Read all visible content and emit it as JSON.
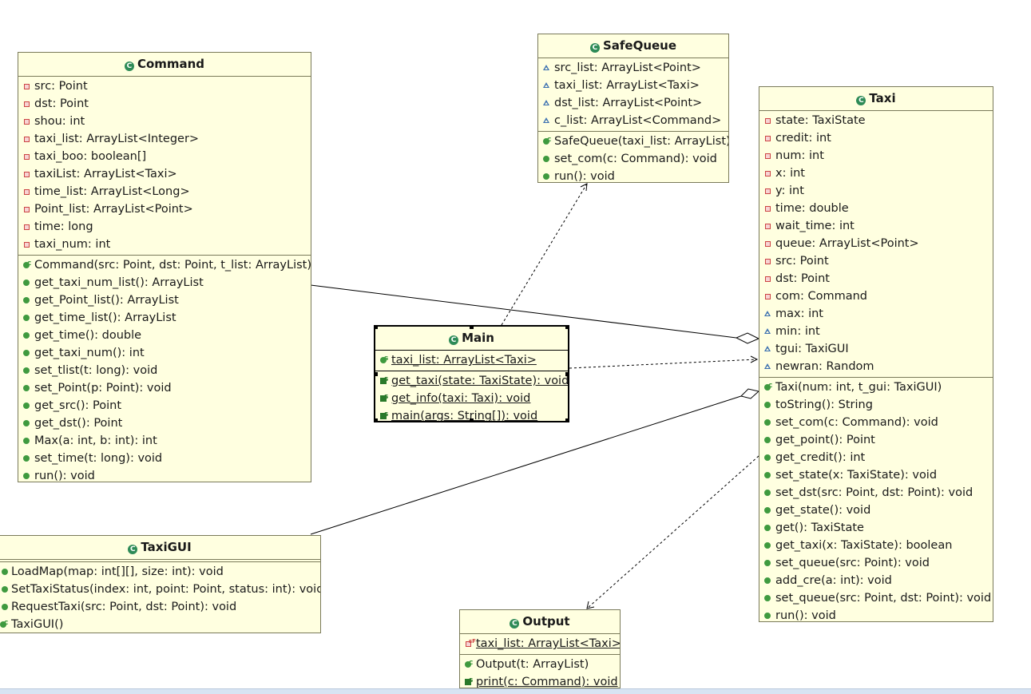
{
  "classes": {
    "command": {
      "name": "Command",
      "attrs": [
        "src: Point",
        "dst: Point",
        "shou: int",
        "taxi_list: ArrayList<Integer>",
        "taxi_boo: boolean[]",
        "taxiList: ArrayList<Taxi>",
        "time_list: ArrayList<Long>",
        "Point_list: ArrayList<Point>",
        "time: long",
        "taxi_num: int"
      ],
      "ops": [
        "Command(src: Point, dst: Point, t_list: ArrayList)",
        "get_taxi_num_list(): ArrayList",
        "get_Point_list(): ArrayList",
        "get_time_list(): ArrayList",
        "get_time(): double",
        "get_taxi_num(): int",
        "set_tlist(t: long): void",
        "set_Point(p: Point): void",
        "get_src(): Point",
        "get_dst(): Point",
        "Max(a: int, b: int): int",
        "set_time(t: long): void",
        "run(): void"
      ]
    },
    "safequeue": {
      "name": "SafeQueue",
      "attrs": [
        "src_list: ArrayList<Point>",
        "taxi_list: ArrayList<Taxi>",
        "dst_list: ArrayList<Point>",
        "c_list: ArrayList<Command>"
      ],
      "ops": [
        "SafeQueue(taxi_list: ArrayList)",
        "set_com(c: Command): void",
        "run(): void"
      ]
    },
    "taxi": {
      "name": "Taxi",
      "attrs": [
        "state: TaxiState",
        "credit: int",
        "num: int",
        "x: int",
        "y: int",
        "time: double",
        "wait_time: int",
        "queue: ArrayList<Point>",
        "src: Point",
        "dst: Point",
        "com: Command",
        "max: int",
        "min: int",
        "tgui: TaxiGUI",
        "newran: Random"
      ],
      "ops": [
        "Taxi(num: int, t_gui: TaxiGUI)",
        "toString(): String",
        "set_com(c: Command): void",
        "get_point(): Point",
        "get_credit(): int",
        "set_state(x: TaxiState): void",
        "set_dst(src: Point, dst: Point): void",
        "get_state(): void",
        "get(): TaxiState",
        "get_taxi(x: TaxiState): boolean",
        "set_queue(src: Point): void",
        "add_cre(a: int): void",
        "set_queue(src: Point, dst: Point): void",
        "run(): void"
      ]
    },
    "main": {
      "name": "Main",
      "attrs": [
        "taxi_list: ArrayList<Taxi>"
      ],
      "ops": [
        "get_taxi(state: TaxiState): void",
        "get_info(taxi: Taxi): void",
        "main(args: String[]): void"
      ]
    },
    "taxigui": {
      "name": "TaxiGUI",
      "attrs": [],
      "ops": [
        "LoadMap(map: int[][], size: int): void",
        "SetTaxiStatus(index: int, point: Point, status: int): void",
        "RequestTaxi(src: Point, dst: Point): void",
        "TaxiGUI()"
      ]
    },
    "output": {
      "name": "Output",
      "attrs": [
        "taxi_list: ArrayList<Taxi>"
      ],
      "ops": [
        "Output(t: ArrayList)",
        "print(c: Command): void"
      ]
    }
  },
  "class_icon_letter": "C",
  "colors": {
    "class_fill": "#ffffe0",
    "border": "#7a7a5a",
    "class_icon": "#2e8b57",
    "edge": "#000000"
  }
}
